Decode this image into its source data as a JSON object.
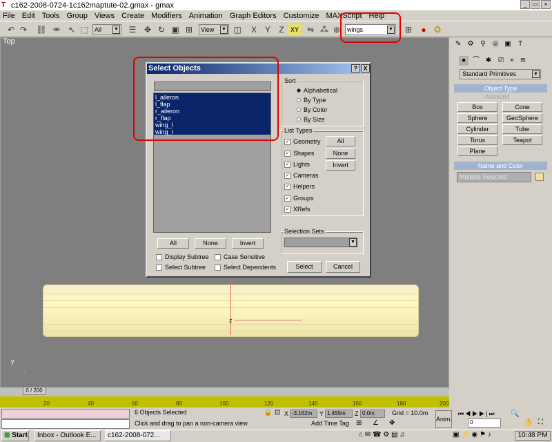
{
  "window": {
    "title": "c162-2008-0724-1c162maptute-02.gmax - gmax"
  },
  "menu": [
    "File",
    "Edit",
    "Tools",
    "Group",
    "Views",
    "Create",
    "Modifiers",
    "Animation",
    "Graph Editors",
    "Customize",
    "MAXScript",
    "Help"
  ],
  "toolbar": {
    "filter_value": "All",
    "view_value": "View",
    "selset_value": "wings",
    "xy_label": "XY"
  },
  "viewport": {
    "label": "Top",
    "z_label": "z",
    "y_label": "y",
    "x_label": "x"
  },
  "dialog": {
    "title": "Select Objects",
    "help_btn": "?",
    "close_btn": "X",
    "objects": [
      "l_aileron",
      "l_flap",
      "r_aileron",
      "r_flap",
      "wing_l",
      "wing_r"
    ],
    "sort_label": "Sort",
    "sort_options": [
      "Alphabetical",
      "By Type",
      "By Color",
      "By Size"
    ],
    "sort_selected": "Alphabetical",
    "list_types_label": "List Types",
    "list_types": [
      "Geometry",
      "Shapes",
      "Lights",
      "Cameras",
      "Helpers",
      "Groups",
      "XRefs"
    ],
    "btn_all": "All",
    "btn_none": "None",
    "btn_invert": "Invert",
    "list_all": "All",
    "list_none": "None",
    "list_invert": "Invert",
    "display_subtree": "Display Subtree",
    "case_sensitive": "Case Sensitive",
    "select_subtree": "Select Subtree",
    "select_dependents": "Select Dependents",
    "selection_sets_label": "Selection Sets",
    "select_btn": "Select",
    "cancel_btn": "Cancel"
  },
  "panel": {
    "primitive_type": "Standard Primitives",
    "object_type_title": "Object Type",
    "autogrid": "AutoGrid",
    "buttons": [
      "Box",
      "Cone",
      "Sphere",
      "GeoSphere",
      "Cylinder",
      "Tube",
      "Torus",
      "Teapot",
      "Plane"
    ],
    "name_color_title": "Name and Color",
    "name_value": "Multiple Selected"
  },
  "timeline": {
    "frame": "0 / 200",
    "ticks": [
      "20",
      "40",
      "60",
      "80",
      "100",
      "120",
      "140",
      "160",
      "180",
      "200"
    ]
  },
  "status": {
    "selected": "6 Objects Selected",
    "hint": "Click and drag to pan a non-camera view",
    "x": "-3.162m",
    "y": "1.455m",
    "z": "0.0m",
    "x_label": "X",
    "y_label": "Y",
    "z_label": "Z",
    "grid": "Grid = 10.0m",
    "add_time_tag": "Add Time Tag",
    "anim": "Anim.",
    "frame_field": "0"
  },
  "taskbar": {
    "start": "Start",
    "task1": "Inbox - Outlook E...",
    "task2": "c162-2008-072...",
    "clock": "10:48 PM"
  },
  "colors": {
    "selection": "#0a246a",
    "highlight": "#e00000",
    "wing": "#fff8c0"
  }
}
